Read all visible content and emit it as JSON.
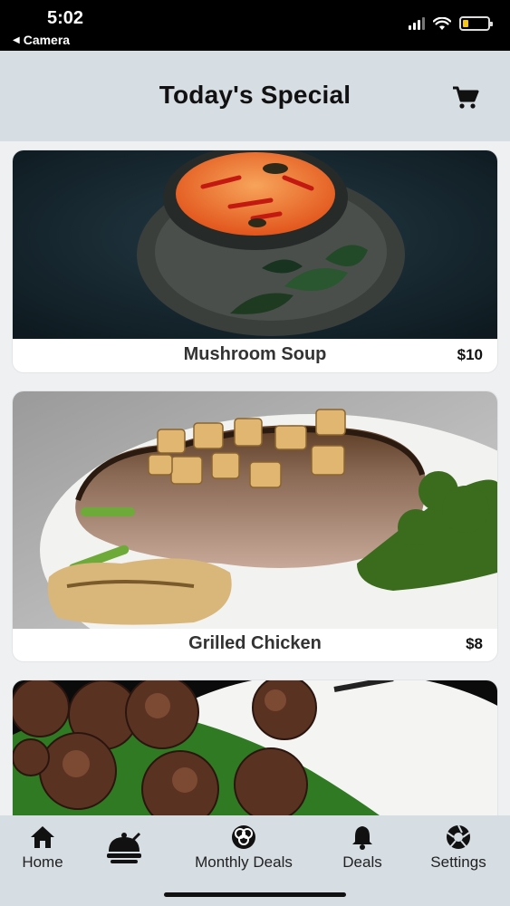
{
  "status_bar": {
    "time": "5:02",
    "back_app": "Camera"
  },
  "header": {
    "title": "Today's Special",
    "cart_icon": "cart-icon"
  },
  "menu_items": [
    {
      "name": "Mushroom Soup",
      "price": "$10"
    },
    {
      "name": "Grilled Chicken",
      "price": "$8"
    }
  ],
  "tab_bar": {
    "tabs": [
      {
        "label": "Home",
        "icon": "home-icon"
      },
      {
        "label": "",
        "icon": "food-cover-icon"
      },
      {
        "label": "Monthly Deals",
        "icon": "deals-circles-icon"
      },
      {
        "label": "Deals",
        "icon": "bell-icon"
      },
      {
        "label": "Settings",
        "icon": "aperture-icon"
      }
    ]
  },
  "colors": {
    "header_bg": "#d6dde3",
    "tab_bar_bg": "#d6dde3",
    "battery_fill": "#f5c518"
  }
}
